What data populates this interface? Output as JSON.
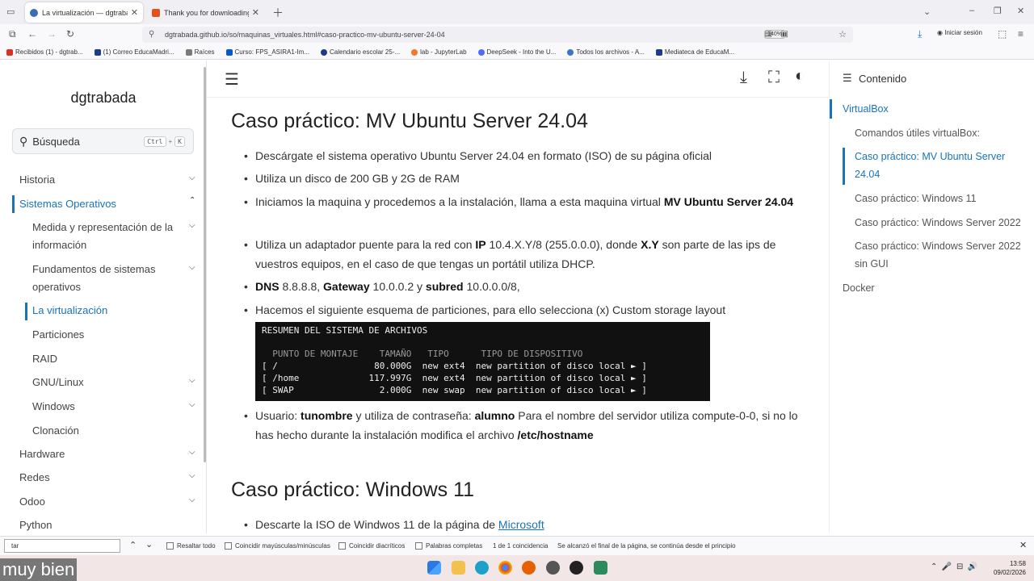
{
  "browser": {
    "tabs": [
      {
        "title": "La virtualización — dgtrabada",
        "active": true
      },
      {
        "title": "Thank you for downloading Ub",
        "active": false
      }
    ],
    "url": "dgtrabada.github.io/so/maquinas_virtuales.html#caso-practico-mv-ubuntu-server-24-04",
    "zoom": "140%",
    "signin": "Iniciar sesión",
    "bookmarks": [
      "Recibidos (1) - dgtrab...",
      "(1) Correo EducaMadri...",
      "Raíces",
      "Curso: FPS_ASIRA1-Im...",
      "Calendario escolar 25-...",
      "lab - JupyterLab",
      "DeepSeek - Into the U...",
      "Todos los archivos - A...",
      "Mediateca de EducaM..."
    ]
  },
  "sidebar": {
    "site_title": "dgtrabada",
    "search_placeholder": "Búsqueda",
    "search_kbd_1": "Ctrl",
    "search_kbd_plus": "+",
    "search_kbd_2": "K",
    "items": [
      {
        "label": "Historia"
      },
      {
        "label": "Sistemas Operativos"
      },
      {
        "label": "Medida y representación de la información"
      },
      {
        "label": "Fundamentos de sistemas operativos"
      },
      {
        "label": "La virtualización"
      },
      {
        "label": "Particiones"
      },
      {
        "label": "RAID"
      },
      {
        "label": "GNU/Linux"
      },
      {
        "label": "Windows"
      },
      {
        "label": "Clonación"
      },
      {
        "label": "Hardware"
      },
      {
        "label": "Redes"
      },
      {
        "label": "Odoo"
      },
      {
        "label": "Python"
      }
    ]
  },
  "content": {
    "h1": "Caso práctico: MV Ubuntu Server 24.04",
    "b1": "Descárgate el sistema operativo Ubuntu Server 24.04 en formato (ISO) de su página oficial",
    "b2": "Utiliza un disco de 200 GB y 2G de RAM",
    "b3_pre": "Iniciamos la maquina y procedemos a la instalación, llama a esta maquina virtual ",
    "b3_bold": "MV Ubuntu Server 24.04",
    "b4_pre": "Utiliza un adaptador puente para la red con ",
    "b4_ip": "IP",
    "b4_mid": " 10.4.X.Y/8 (255.0.0.0), donde ",
    "b4_xy": "X.Y",
    "b4_post": " son parte de las ips de vuestros equipos, en el caso de que tengas un portátil utiliza DHCP.",
    "b5_dns": "DNS",
    "b5_dns_val": " 8.8.8.8, ",
    "b5_gw": "Gateway",
    "b5_gw_val": " 10.0.0.2 y ",
    "b5_sub": "subred",
    "b5_sub_val": " 10.0.0.0/8,",
    "b6": "Hacemos el siguiente esquema de particiones, para ello selecciona (x) Custom storage layout",
    "terminal": {
      "line1": "RESUMEN DEL SISTEMA DE ARCHIVOS",
      "line2": "  PUNTO DE MONTAJE    TAMAÑO   TIPO      TIPO DE DISPOSITIVO",
      "line3": "[ /                  80.000G  new ext4  new partition of disco local ► ]",
      "line4": "[ /home             117.997G  new ext4  new partition of disco local ► ]",
      "line5": "[ SWAP                2.000G  new swap  new partition of disco local ► ]"
    },
    "b7_pre": "Usuario: ",
    "b7_user": "tunombre",
    "b7_mid": " y utiliza de contraseña: ",
    "b7_pass": "alumno",
    "b7_mid2": " Para el nombre del servidor utiliza compute-0-0, si no lo has hecho durante la instalación modifica el archivo ",
    "b7_file": "/etc/hostname",
    "h2": "Caso práctico: Windows 11",
    "b8_pre": "Descarte la ISO de Windwos 11 de la página de ",
    "b8_link": "Microsoft"
  },
  "toc": {
    "title": "Contenido",
    "items": [
      "VirtualBox",
      "Comandos útiles virtualBox:",
      "Caso práctico: MV Ubuntu Server 24.04",
      "Caso práctico: Windows 11",
      "Caso práctico: Windows Server 2022",
      "Caso práctico: Windows Server 2022 sin GUI",
      "Docker"
    ]
  },
  "findbar": {
    "query": "tar",
    "opt1": "Resaltar todo",
    "opt2": "Coincidir mayúsculas/minúsculas",
    "opt3": "Coincidir diacríticos",
    "opt4": "Palabras completas",
    "count": "1 de 1 coincidencia",
    "status": "Se alcanzó el final de la página, se continúa desde el principio"
  },
  "taskbar": {
    "time": "13:58",
    "date": "09/02/2026",
    "caption": "muy bien"
  },
  "colors": {
    "accent": "#1a73b8",
    "taskbar": "#f3e6e6"
  }
}
